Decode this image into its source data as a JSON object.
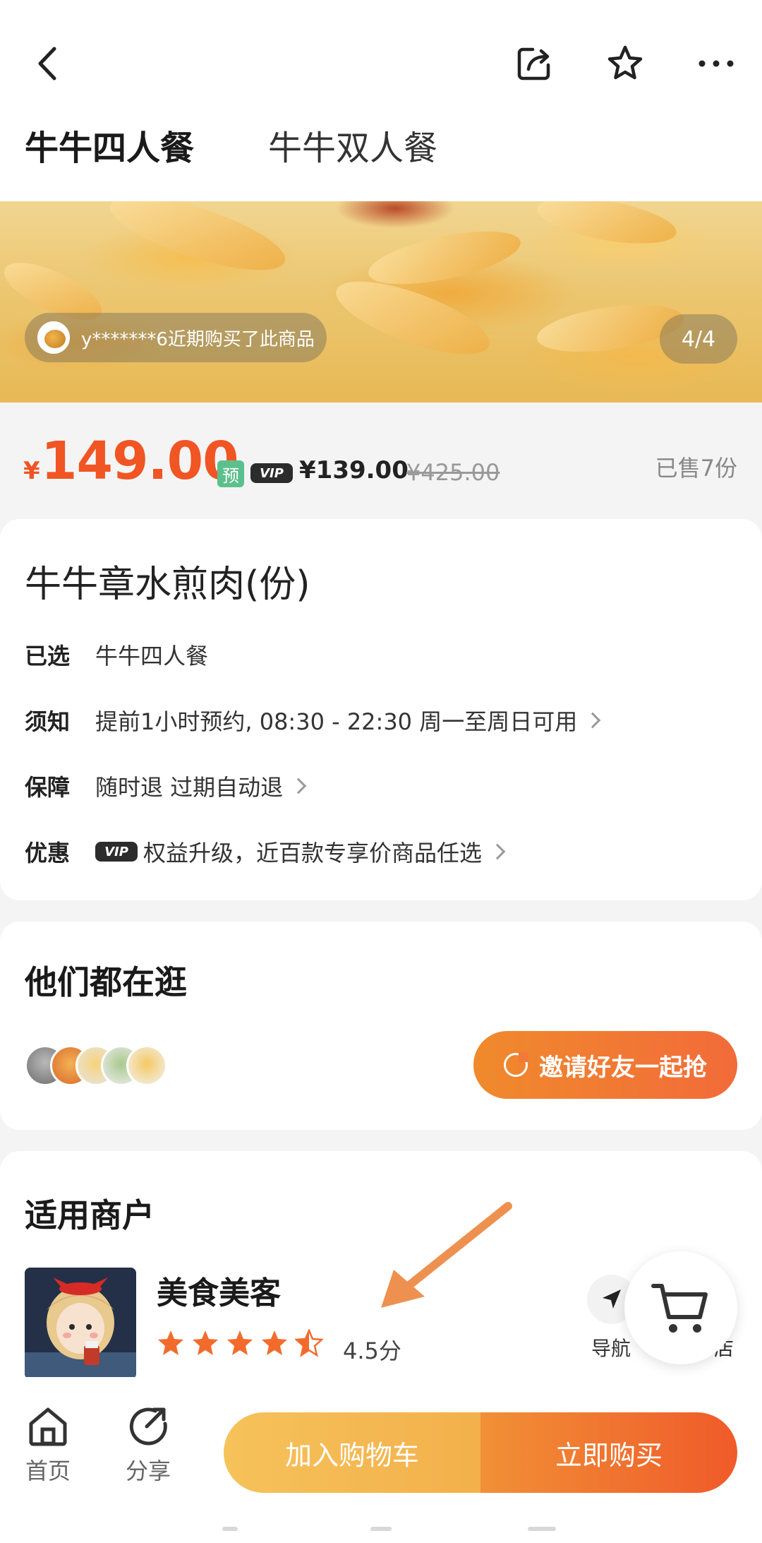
{
  "header": {
    "tabs": [
      {
        "label": "牛牛四人餐",
        "active": true
      },
      {
        "label": "牛牛双人餐",
        "active": false
      }
    ]
  },
  "hero": {
    "buyer_notice": "y*******6近期购买了此商品",
    "image_counter": "4/4"
  },
  "price": {
    "currency": "¥",
    "current": "149.00",
    "pre_badge": "预",
    "vip_badge": "VIP",
    "vip_price": "¥139.00",
    "original_price": "¥425.00",
    "sold": "已售7份"
  },
  "product": {
    "title": "牛牛章水煎肉(份)",
    "rows": [
      {
        "label": "已选",
        "value": "牛牛四人餐"
      },
      {
        "label": "须知",
        "value": "提前1小时预约, 08:30 - 22:30 周一至周日可用"
      },
      {
        "label": "保障",
        "value": "随时退 过期自动退"
      },
      {
        "label": "优惠",
        "vip": "VIP",
        "value": "权益升级，近百款专享价商品任选"
      }
    ]
  },
  "browse": {
    "title": "他们都在逛",
    "invite_label": "邀请好友一起抢"
  },
  "merchant": {
    "section_title": "适用商户",
    "name": "美食美客",
    "rating": 4.5,
    "score_text": "4.5分",
    "nav_label": "导航",
    "more_label": "店"
  },
  "bottom": {
    "home_label": "首页",
    "share_label": "分享",
    "add_cart_label": "加入购物车",
    "buy_now_label": "立即购买"
  },
  "colors": {
    "accent": "#f05523",
    "orange_gradient_start": "#f08a2c",
    "orange_gradient_end": "#f26b3a",
    "yellow_button": "#f6c25a",
    "pre_badge_green": "#5cc08c"
  }
}
